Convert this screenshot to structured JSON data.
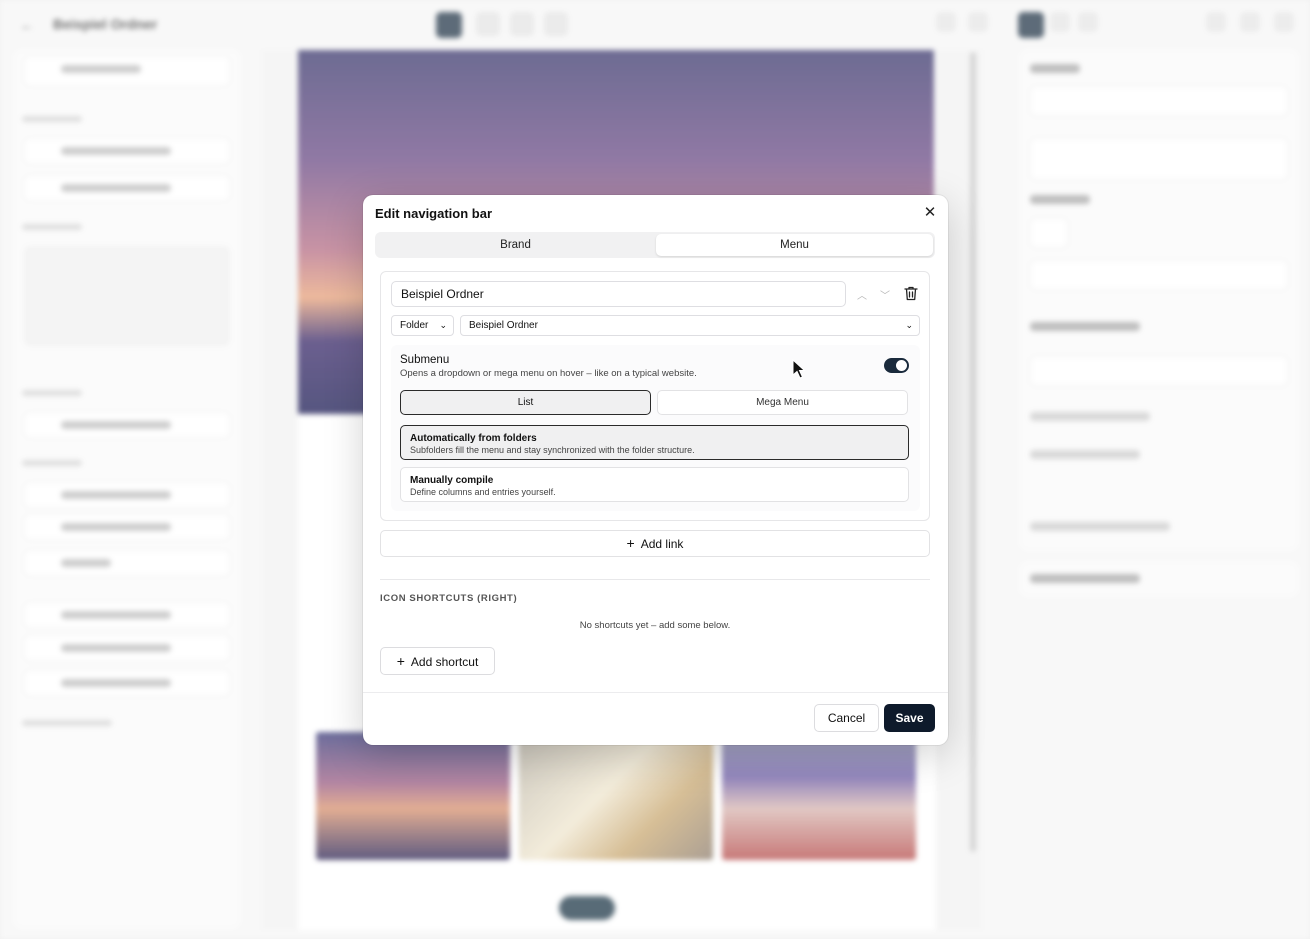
{
  "background": {
    "page_title": "Beispiel Ordner"
  },
  "modal": {
    "title": "Edit navigation bar",
    "close_symbol": "✕",
    "tabs": [
      {
        "label": "Brand",
        "active": false
      },
      {
        "label": "Menu",
        "active": true
      }
    ],
    "menu_item": {
      "name": "Beispiel Ordner",
      "type_select": "Folder",
      "folder_select": "Beispiel Ordner",
      "submenu": {
        "title": "Submenu",
        "description": "Opens a dropdown or mega menu on hover – like on a typical website.",
        "enabled": true,
        "modes": [
          {
            "label": "List",
            "selected": true
          },
          {
            "label": "Mega Menu",
            "selected": false
          }
        ],
        "options": [
          {
            "title": "Automatically from folders",
            "description": "Subfolders fill the menu and stay synchronized with the folder structure.",
            "selected": true
          },
          {
            "title": "Manually compile",
            "description": "Define columns and entries yourself.",
            "selected": false
          }
        ]
      }
    },
    "add_link_label": "Add link",
    "shortcuts": {
      "section_label": "ICON SHORTCUTS (RIGHT)",
      "empty_text": "No shortcuts yet – add some below.",
      "add_label": "Add shortcut"
    },
    "footer": {
      "cancel_label": "Cancel",
      "save_label": "Save"
    }
  },
  "colors": {
    "primary": "#0e1a2b",
    "toggle_on": "#1a2a3c",
    "border": "#e2e2e4"
  }
}
